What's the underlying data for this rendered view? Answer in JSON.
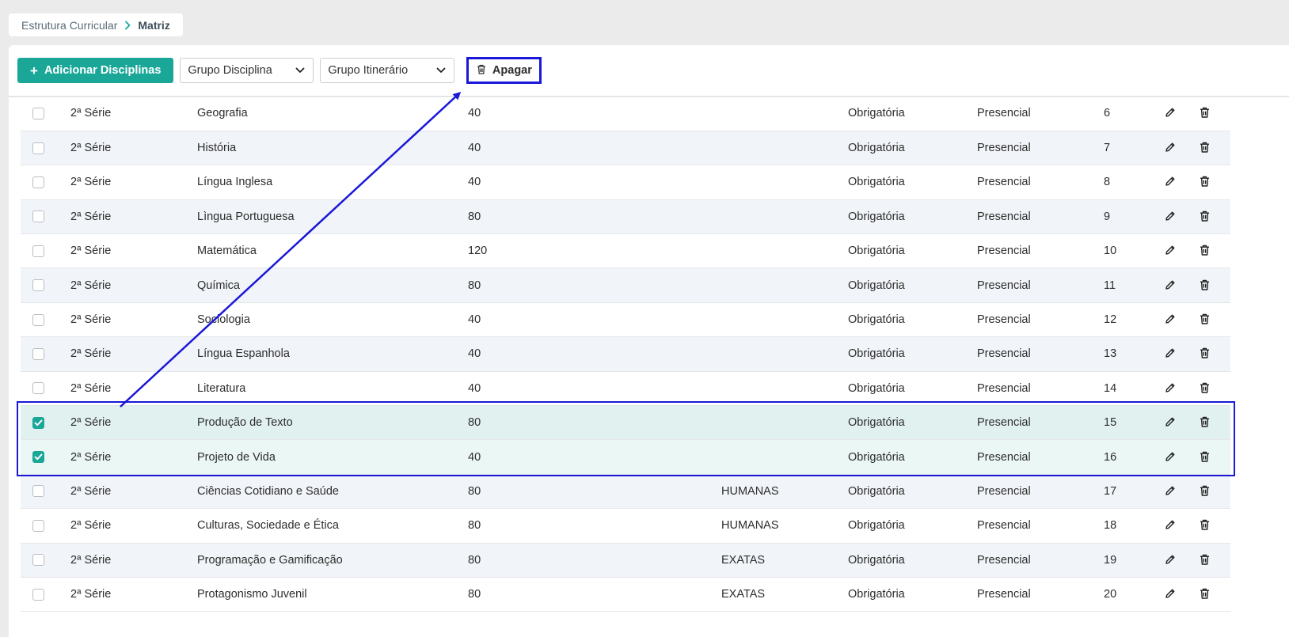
{
  "breadcrumb": {
    "items": [
      "Estrutura Curricular",
      "Matriz"
    ]
  },
  "toolbar": {
    "add_label": "Adicionar Disciplinas",
    "grupo_disciplina": "Grupo Disciplina",
    "grupo_itinerario": "Grupo Itinerário",
    "delete_label": "Apagar"
  },
  "colors": {
    "accent": "#1aa798",
    "annotation": "#1a18d8"
  },
  "rows": [
    {
      "checked": false,
      "serie": "2ª Série",
      "disciplina": "Geografia",
      "carga": "40",
      "grupo": "",
      "tipo": "Obrigatória",
      "modalidade": "Presencial",
      "ordem": "6"
    },
    {
      "checked": false,
      "serie": "2ª Série",
      "disciplina": "História",
      "carga": "40",
      "grupo": "",
      "tipo": "Obrigatória",
      "modalidade": "Presencial",
      "ordem": "7"
    },
    {
      "checked": false,
      "serie": "2ª Série",
      "disciplina": "Língua Inglesa",
      "carga": "40",
      "grupo": "",
      "tipo": "Obrigatória",
      "modalidade": "Presencial",
      "ordem": "8"
    },
    {
      "checked": false,
      "serie": "2ª Série",
      "disciplina": "Lìngua Portuguesa",
      "carga": "80",
      "grupo": "",
      "tipo": "Obrigatória",
      "modalidade": "Presencial",
      "ordem": "9"
    },
    {
      "checked": false,
      "serie": "2ª Série",
      "disciplina": "Matemática",
      "carga": "120",
      "grupo": "",
      "tipo": "Obrigatória",
      "modalidade": "Presencial",
      "ordem": "10"
    },
    {
      "checked": false,
      "serie": "2ª Série",
      "disciplina": "Química",
      "carga": "80",
      "grupo": "",
      "tipo": "Obrigatória",
      "modalidade": "Presencial",
      "ordem": "11"
    },
    {
      "checked": false,
      "serie": "2ª Série",
      "disciplina": "Sociologia",
      "carga": "40",
      "grupo": "",
      "tipo": "Obrigatória",
      "modalidade": "Presencial",
      "ordem": "12"
    },
    {
      "checked": false,
      "serie": "2ª Série",
      "disciplina": "Língua Espanhola",
      "carga": "40",
      "grupo": "",
      "tipo": "Obrigatória",
      "modalidade": "Presencial",
      "ordem": "13"
    },
    {
      "checked": false,
      "serie": "2ª Série",
      "disciplina": "Literatura",
      "carga": "40",
      "grupo": "",
      "tipo": "Obrigatória",
      "modalidade": "Presencial",
      "ordem": "14"
    },
    {
      "checked": true,
      "serie": "2ª Série",
      "disciplina": "Produção de Texto",
      "carga": "80",
      "grupo": "",
      "tipo": "Obrigatória",
      "modalidade": "Presencial",
      "ordem": "15"
    },
    {
      "checked": true,
      "serie": "2ª Série",
      "disciplina": "Projeto de Vida",
      "carga": "40",
      "grupo": "",
      "tipo": "Obrigatória",
      "modalidade": "Presencial",
      "ordem": "16"
    },
    {
      "checked": false,
      "serie": "2ª Série",
      "disciplina": "Ciências Cotidiano e Saúde",
      "carga": "80",
      "grupo": "HUMANAS",
      "tipo": "Obrigatória",
      "modalidade": "Presencial",
      "ordem": "17"
    },
    {
      "checked": false,
      "serie": "2ª Série",
      "disciplina": "Culturas, Sociedade e Ética",
      "carga": "80",
      "grupo": "HUMANAS",
      "tipo": "Obrigatória",
      "modalidade": "Presencial",
      "ordem": "18"
    },
    {
      "checked": false,
      "serie": "2ª Série",
      "disciplina": "Programação e Gamificação",
      "carga": "80",
      "grupo": "EXATAS",
      "tipo": "Obrigatória",
      "modalidade": "Presencial",
      "ordem": "19"
    },
    {
      "checked": false,
      "serie": "2ª Série",
      "disciplina": "Protagonismo Juvenil",
      "carga": "80",
      "grupo": "EXATAS",
      "tipo": "Obrigatória",
      "modalidade": "Presencial",
      "ordem": "20"
    }
  ]
}
